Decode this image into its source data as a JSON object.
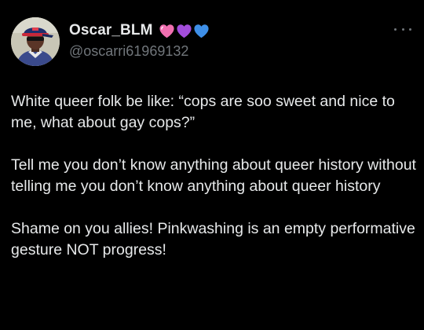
{
  "tweet": {
    "author": {
      "display_name": "Oscar_BLM",
      "handle": "@oscarri61969132",
      "avatar_icon": "person-avatar",
      "emoji": [
        {
          "name": "pink-heart-icon",
          "color": "#f06fb0"
        },
        {
          "name": "purple-heart-icon",
          "color": "#a24ddb"
        },
        {
          "name": "blue-heart-icon",
          "color": "#3e8fe8"
        }
      ]
    },
    "more_icon": "more-dots-icon",
    "paragraphs": [
      "White queer folk be like: “cops are soo sweet and nice to me, what about gay cops?”",
      "Tell me you don’t know anything about queer history without telling me you don’t know anything about queer history",
      "Shame on you allies! Pinkwashing is an empty performative gesture NOT progress!"
    ]
  },
  "colors": {
    "background": "#000000",
    "primary_text": "#e7e9ea",
    "secondary_text": "#71767b"
  }
}
